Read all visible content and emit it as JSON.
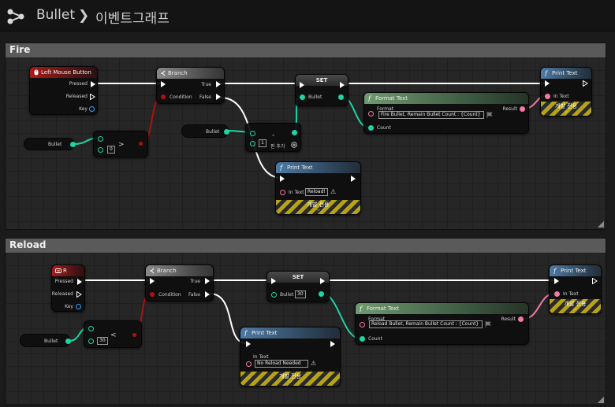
{
  "breadcrumb": {
    "asset": "Bullet",
    "graph": "이벤트그래프"
  },
  "fire_panel": {
    "title": "Fire",
    "lmb": {
      "title": "Left Mouse Button",
      "pressed": "Pressed",
      "released": "Released",
      "key": "Key"
    },
    "bullet_get_1": {
      "label": "Bullet"
    },
    "compare_gt": {
      "b_value": "0",
      "op": ">"
    },
    "branch": {
      "title": "Branch",
      "condition": "Condition",
      "true": "True",
      "false": "False"
    },
    "bullet_get_2": {
      "label": "Bullet"
    },
    "subtract": {
      "op": "-",
      "b_value": "1",
      "add_pin": "핀 추가"
    },
    "set": {
      "title": "SET",
      "var": "Bullet"
    },
    "format_text": {
      "title": "Format Text",
      "format_label": "Format",
      "format_value": "Fire Bullet, Remain Bullet Count : {Count}",
      "count": "Count",
      "result": "Result"
    },
    "print_main": {
      "title": "Print Text",
      "in_text": "In Text",
      "dev": "개발 전용"
    },
    "print_reload": {
      "title": "Print Text",
      "in_text": "In Text",
      "value": "Reload!",
      "dev": "개발 전용"
    }
  },
  "reload_panel": {
    "title": "Reload",
    "r_key": {
      "title": "R",
      "pressed": "Pressed",
      "released": "Released",
      "key": "Key"
    },
    "bullet_get": {
      "label": "Bullet"
    },
    "compare_lt": {
      "b_value": "30",
      "op": "<"
    },
    "branch": {
      "title": "Branch",
      "condition": "Condition",
      "true": "True",
      "false": "False"
    },
    "set": {
      "title": "SET",
      "var": "Bullet",
      "value": "30"
    },
    "format_text": {
      "title": "Format Text",
      "format_label": "Format",
      "format_value": "Reload Bullet, Remain Bullet Count : {Count}",
      "count": "Count",
      "result": "Result"
    },
    "print_main": {
      "title": "Print Text",
      "in_text": "In Text",
      "dev": "개발 전용"
    },
    "print_no": {
      "title": "Print Text",
      "in_text": "In Text",
      "value": "No Reload Needed",
      "dev": "개발 전용"
    }
  },
  "colors": {
    "exec": "#ffffff",
    "integer": "#1fd3a6",
    "bool": "#b01010",
    "text": "#f07aa0"
  }
}
